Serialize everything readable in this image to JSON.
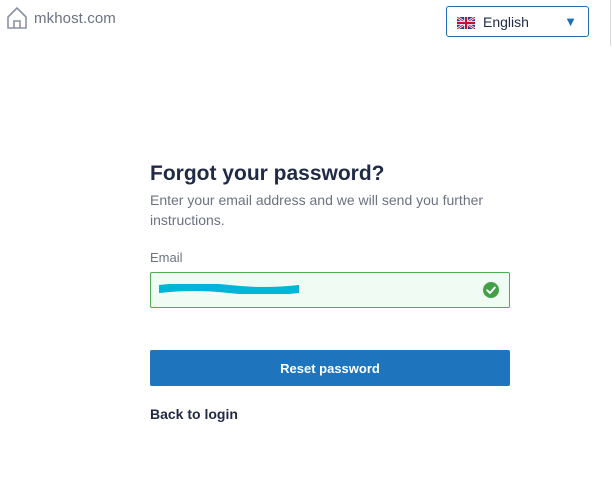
{
  "header": {
    "site_name": "mkhost.com",
    "home_icon": "home-icon",
    "language": {
      "selected": "English",
      "flag_icon": "uk-flag-icon",
      "caret_icon": "caret-down-icon"
    }
  },
  "form": {
    "title": "Forgot your password?",
    "subtitle": "Enter your email address and we will send you further instructions.",
    "email_label": "Email",
    "email_value": "",
    "email_valid_icon": "check-circle-icon",
    "submit_label": "Reset password",
    "back_link": "Back to login"
  },
  "colors": {
    "primary": "#1e74bd",
    "valid_border": "#4caf50",
    "valid_bg": "#f0fcf3",
    "redaction": "#00b5d8",
    "title": "#1f2a44",
    "muted": "#6b7280"
  }
}
